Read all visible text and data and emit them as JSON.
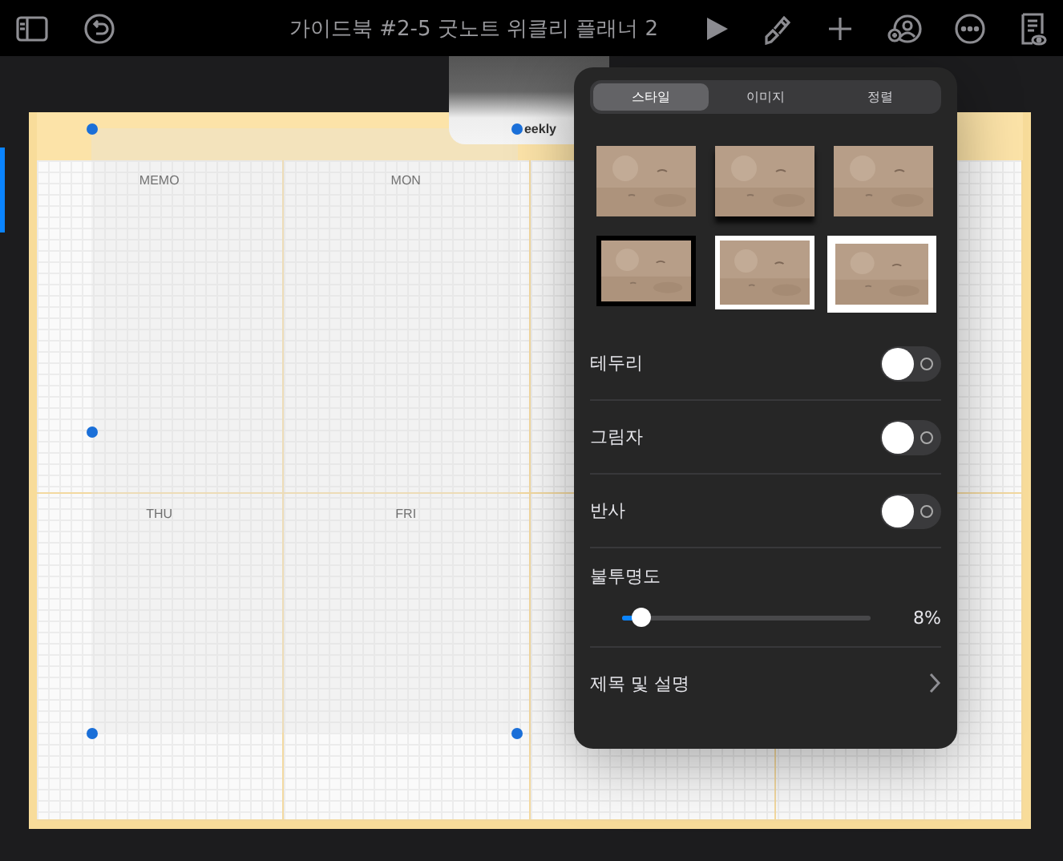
{
  "toolbar": {
    "title": "가이드북 #2-5 굿노트 위클리 플래너 2"
  },
  "planner": {
    "header_peek": "eekly",
    "rows": [
      [
        "MEMO",
        "MON"
      ],
      [
        "THU",
        "FRI"
      ]
    ]
  },
  "popover": {
    "tabs": [
      {
        "label": "스타일",
        "selected": true
      },
      {
        "label": "이미지",
        "selected": false
      },
      {
        "label": "정렬",
        "selected": false
      }
    ],
    "styles": [
      {
        "kind": "plain"
      },
      {
        "kind": "shadow"
      },
      {
        "kind": "plain"
      },
      {
        "kind": "black-frame"
      },
      {
        "kind": "white-frame"
      },
      {
        "kind": "thick-white-frame"
      }
    ],
    "toggles": [
      {
        "label": "테두리",
        "on": false
      },
      {
        "label": "그림자",
        "on": false
      },
      {
        "label": "반사",
        "on": false
      }
    ],
    "opacity": {
      "label": "불투명도",
      "level": 0.08,
      "reading": "8%"
    },
    "link": {
      "label": "제목 및 설명"
    }
  }
}
